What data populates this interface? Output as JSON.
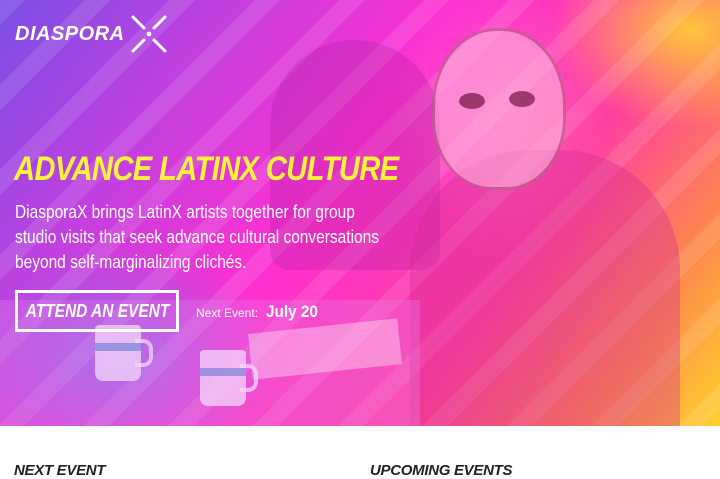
{
  "brand": {
    "logo_text": "DIASPORA",
    "logo_icon": "x-mark-icon"
  },
  "hero": {
    "headline": "ADVANCE LATINX CULTURE",
    "description": "DiasporaX brings LatinX artists together for group studio visits that seek advance cultural conversations beyond self-marginalizing clichés.",
    "cta_label": "ATTEND AN EVENT",
    "next_event_label": "Next Event:",
    "next_event_date": "July 20"
  },
  "sections": {
    "next_event_heading": "NEXT EVENT",
    "upcoming_events_heading": "UPCOMING EVENTS"
  },
  "colors": {
    "headline": "#fff23d",
    "gradient_pink": "#ff2fd0",
    "gradient_violet": "#7a4fe6",
    "gradient_yellow": "#ffd12e"
  }
}
